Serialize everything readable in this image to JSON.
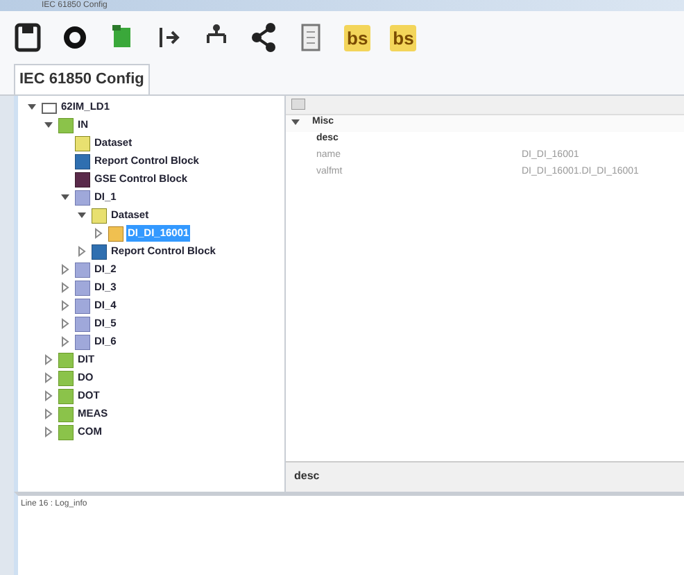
{
  "window": {
    "title": "IEC 61850 Config"
  },
  "toolbar": [
    {
      "kind": "save"
    },
    {
      "kind": "gear"
    },
    {
      "kind": "green"
    },
    {
      "kind": "import"
    },
    {
      "kind": "tree"
    },
    {
      "kind": "share"
    },
    {
      "kind": "doc"
    },
    {
      "kind": "text",
      "text": "bs"
    },
    {
      "kind": "text",
      "text": "bs"
    }
  ],
  "tab": {
    "label": "IEC 61850 Config"
  },
  "tree": [
    {
      "label": "62IM_LD1",
      "kind": "folder",
      "expanded": true,
      "selected": false,
      "children": [
        {
          "label": "IN",
          "kind": "ln",
          "expanded": true,
          "selected": false,
          "children": [
            {
              "label": "Dataset",
              "kind": "dataset",
              "selected": false
            },
            {
              "label": "Report Control Block",
              "kind": "report",
              "selected": false
            },
            {
              "label": "GSE Control Block",
              "kind": "gse",
              "selected": false
            },
            {
              "label": "DI_1",
              "kind": "ld",
              "expanded": true,
              "selected": false,
              "children": [
                {
                  "label": "Dataset",
                  "kind": "dataset",
                  "expanded": true,
                  "selected": false,
                  "children": [
                    {
                      "label": "DI_DI_16001",
                      "kind": "item",
                      "expanded": false,
                      "selected": true
                    }
                  ]
                },
                {
                  "label": "Report Control Block",
                  "kind": "report",
                  "expanded": false,
                  "selected": false
                }
              ]
            },
            {
              "label": "DI_2",
              "kind": "ld",
              "expanded": false,
              "selected": false
            },
            {
              "label": "DI_3",
              "kind": "ld",
              "expanded": false,
              "selected": false
            },
            {
              "label": "DI_4",
              "kind": "ld",
              "expanded": false,
              "selected": false
            },
            {
              "label": "DI_5",
              "kind": "ld",
              "expanded": false,
              "selected": false
            },
            {
              "label": "DI_6",
              "kind": "ld",
              "expanded": false,
              "selected": false
            }
          ]
        },
        {
          "label": "DIT",
          "kind": "ln",
          "expanded": false,
          "selected": false
        },
        {
          "label": "DO",
          "kind": "ln",
          "expanded": false,
          "selected": false
        },
        {
          "label": "DOT",
          "kind": "ln",
          "expanded": false,
          "selected": false
        },
        {
          "label": "MEAS",
          "kind": "ln",
          "expanded": false,
          "selected": false
        },
        {
          "label": "COM",
          "kind": "ln",
          "expanded": false,
          "selected": false
        }
      ]
    }
  ],
  "properties": {
    "category": "Misc",
    "rows": [
      {
        "name": "desc",
        "value": "",
        "selected": true
      },
      {
        "name": "name",
        "value": "DI_DI_16001",
        "selected": false
      },
      {
        "name": "valfmt",
        "value": "DI_DI_16001.DI_DI_16001",
        "selected": false
      }
    ],
    "description": "desc"
  },
  "log": {
    "lines": [
      "Line 16 : Log_info"
    ]
  }
}
